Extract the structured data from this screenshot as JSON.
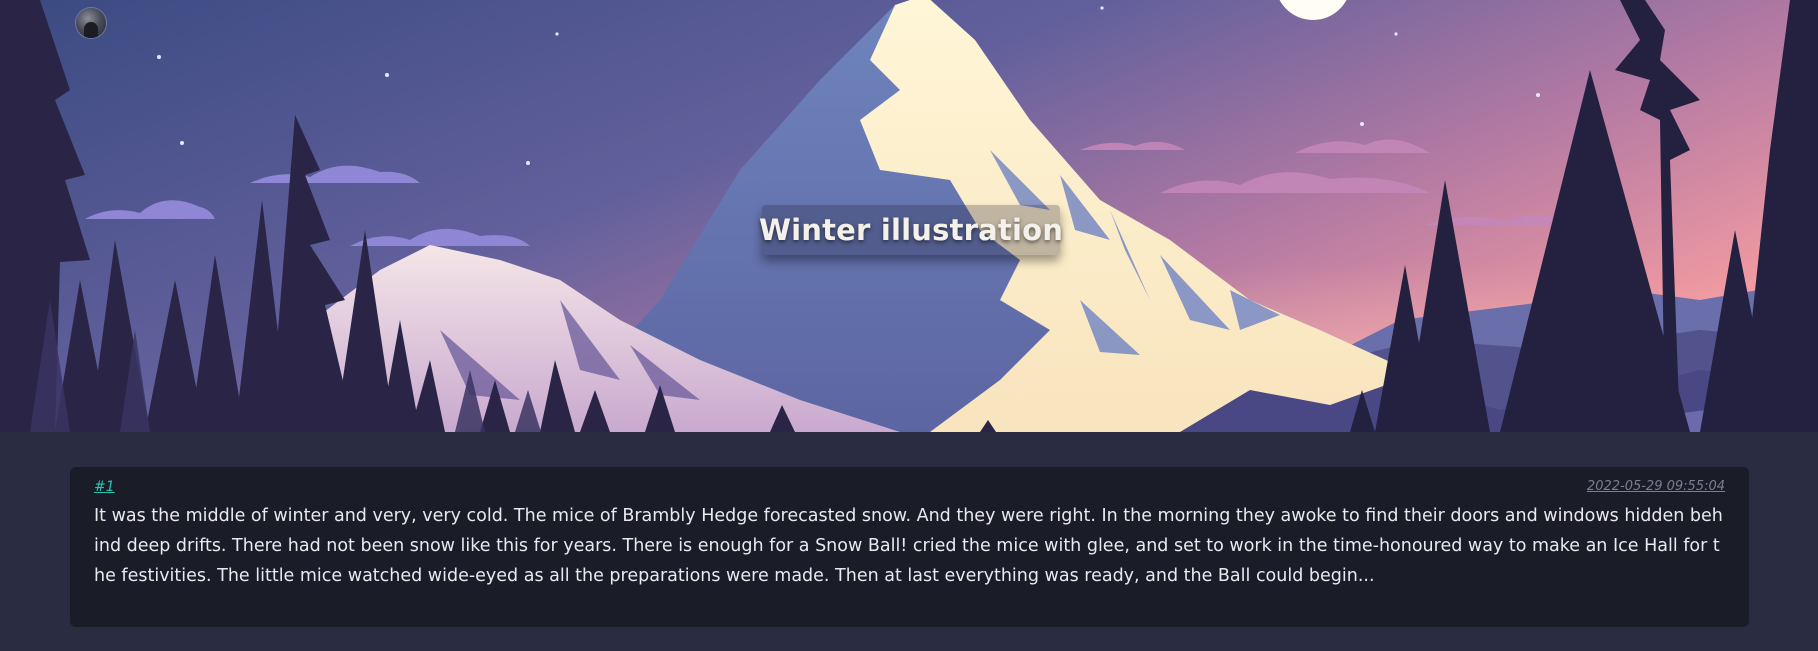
{
  "header": {
    "title": "Winter illustration",
    "avatar_icon": "avatar-icon",
    "search_icon": "search-icon",
    "menu_icon": "menu-icon"
  },
  "post": {
    "id": "#1",
    "timestamp": "2022-05-29 09:55:04",
    "excerpt": "It was the middle of winter and very, very cold. The mice of Brambly Hedge forecasted snow. And they were right. In the morning they awoke to find their doors and windows hidden behind deep drifts. There had not been snow like this for years. There is enough for a Snow Ball! cried the mice with glee, and set to work in the time-honoured way to make an Ice Hall for the festivities. The little mice watched wide-eyed as all the preparations were made. Then at last everything was ready, and the Ball could begin..."
  },
  "theme": {
    "background": "#2a2d42",
    "card_background": "#1a1c28",
    "link_color": "#27c4b2",
    "muted_text": "#7b7e90",
    "body_text": "#e9e9ee"
  }
}
